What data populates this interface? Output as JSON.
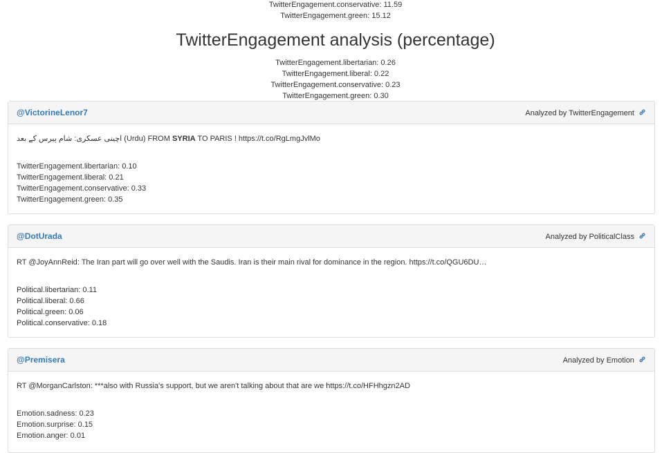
{
  "top_stats": [
    "TwitterEngagement.conservative: 11.59",
    "TwitterEngagement.green: 15.12"
  ],
  "page_title": "TwitterEngagement analysis (percentage)",
  "summary_stats": [
    "TwitterEngagement.libertarian: 0.26",
    "TwitterEngagement.liberal: 0.22",
    "TwitterEngagement.conservative: 0.23",
    "TwitterEngagement.green: 0.30"
  ],
  "panels": [
    {
      "user": "@VictorineLenor7",
      "analyzed_by": "Analyzed by TwitterEngagement",
      "tweet_pre": "اچینی عسکری: شام پیرس کے بعد (Urdu) FROM ",
      "tweet_bold": "SYRIA",
      "tweet_post": " TO PARIS ! https://t.co/RgLmgJvlMo",
      "scores": [
        "TwitterEngagement.libertarian: 0.10",
        "TwitterEngagement.liberal: 0.21",
        "TwitterEngagement.conservative: 0.33",
        "TwitterEngagement.green: 0.35"
      ]
    },
    {
      "user": "@DotUrada",
      "analyzed_by": "Analyzed by PoliticalClass",
      "tweet": "RT @JoyAnnReid: The Iran part will go over well with the Saudis. Iran is their main rival for dominance in the region. https://t.co/QGU6DU…",
      "scores": [
        "Political.libertarian: 0.11",
        "Political.liberal: 0.66",
        "Political.green: 0.06",
        "Political.conservative: 0.18"
      ]
    },
    {
      "user": "@Premisera",
      "analyzed_by": "Analyzed by Emotion",
      "tweet": "RT @MorganCarlston: ***also with Russia's support, but we aren't talking about that are we https://t.co/HFHhgzn2AD",
      "scores": [
        "Emotion.sadness: 0.23",
        "Emotion.surprise: 0.15",
        "Emotion.anger: 0.01"
      ]
    }
  ],
  "icons": {
    "link": "link-icon"
  },
  "colors": {
    "user_link": "#337ab7",
    "panel_heading_bg": "#f5f5f5",
    "panel_border": "#dddddd",
    "text": "#333333"
  }
}
